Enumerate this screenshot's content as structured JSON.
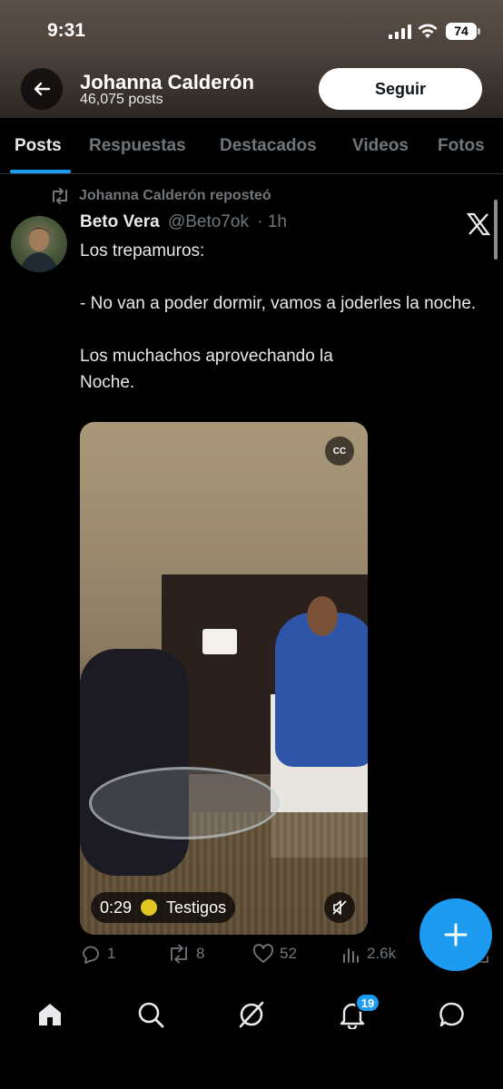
{
  "status_bar": {
    "time": "9:31",
    "battery": "74"
  },
  "profile": {
    "name": "Johanna Calderón",
    "posts_count": "46,075 posts",
    "follow_label": "Seguir"
  },
  "tabs": [
    {
      "label": "Posts",
      "active": true
    },
    {
      "label": "Respuestas",
      "active": false
    },
    {
      "label": "Destacados",
      "active": false
    },
    {
      "label": "Videos",
      "active": false
    },
    {
      "label": "Fotos",
      "active": false
    }
  ],
  "post": {
    "repost_label": "Johanna Calderón reposteó",
    "author_name": "Beto Vera",
    "author_handle": "@Beto7ok",
    "time": "· 1h",
    "text_lines": [
      "Los trepamuros:",
      "",
      "- No van a poder dormir, vamos a joderles la noche.",
      "",
      "Los muchachos aprovechando la",
      "Noche."
    ],
    "video": {
      "duration": "0:29",
      "source_label": "Testigos",
      "cc_label": "CC"
    },
    "actions": {
      "replies": "1",
      "reposts": "8",
      "likes": "52",
      "views": "2.6k"
    }
  },
  "nav": {
    "notifications_badge": "19"
  },
  "colors": {
    "accent": "#1d9bf0",
    "muted": "#71767b",
    "text": "#e7e9ea",
    "background": "#000000"
  },
  "icons": [
    "back-arrow-icon",
    "repost-icon",
    "x-logo-icon",
    "cc-icon",
    "mute-icon",
    "reply-icon",
    "like-icon",
    "views-icon",
    "share-icon",
    "compose-plus-icon",
    "home-icon",
    "search-icon",
    "grok-icon",
    "bell-icon",
    "messages-icon"
  ]
}
